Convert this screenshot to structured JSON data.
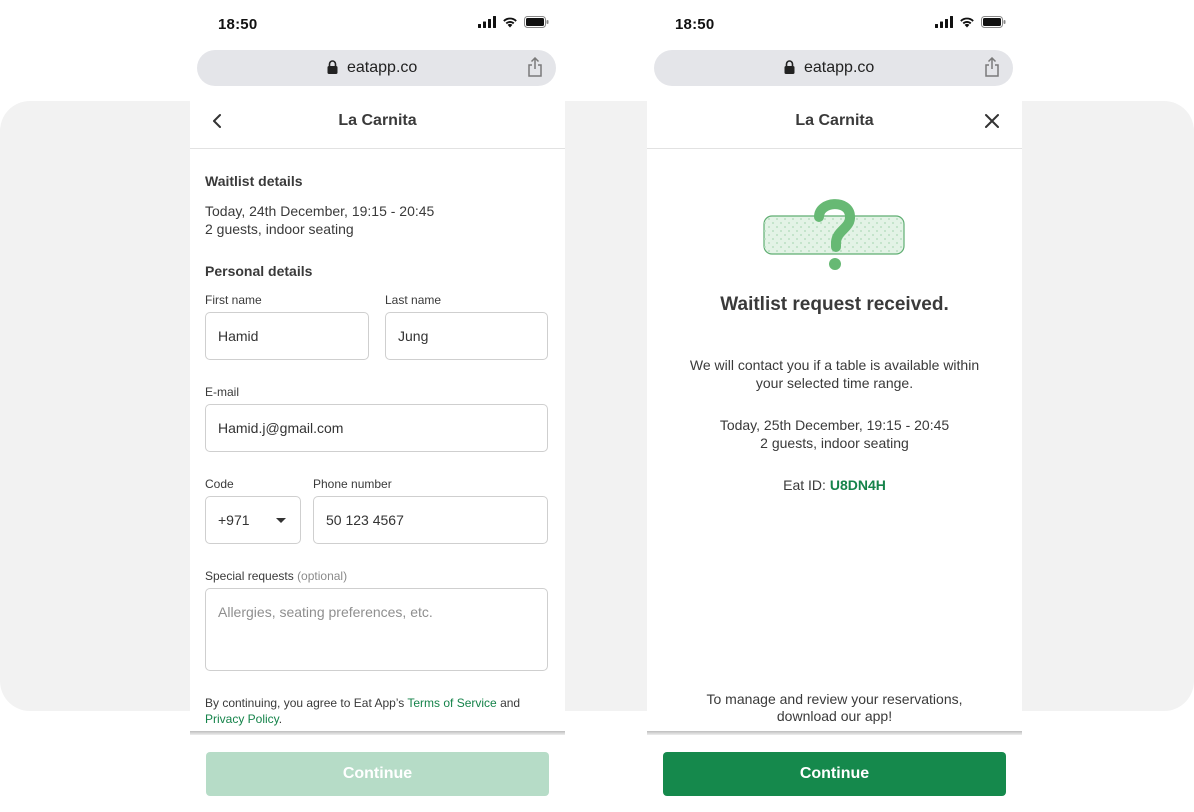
{
  "status_bar": {
    "time": "18:50"
  },
  "browser": {
    "url": "eatapp.co"
  },
  "colors": {
    "accent": "#15894c",
    "accent_disabled": "#b6dcc7",
    "link": "#15834a"
  },
  "left_screen": {
    "header": {
      "title": "La Carnita",
      "back_icon": "chevron-left-icon"
    },
    "waitlist": {
      "title": "Waitlist details",
      "date_line": "Today, 24th December, 19:15 - 20:45",
      "guests_line": "2 guests, indoor seating"
    },
    "personal": {
      "title": "Personal details",
      "first_name": {
        "label": "First name",
        "value": "Hamid"
      },
      "last_name": {
        "label": "Last name",
        "value": "Jung"
      },
      "email": {
        "label": "E-mail",
        "value": "Hamid.j@gmail.com"
      },
      "code": {
        "label": "Code",
        "value": "+971"
      },
      "phone": {
        "label": "Phone number",
        "value": "50 123 4567"
      },
      "special": {
        "label": "Special requests",
        "optional": "(optional)",
        "placeholder": "Allergies, seating preferences, etc."
      }
    },
    "legal": {
      "prefix": "By continuing, you agree to Eat App’s ",
      "terms": "Terms of Service",
      "and": " and ",
      "privacy": "Privacy Policy",
      "suffix": "."
    },
    "continue_label": "Continue"
  },
  "right_screen": {
    "header": {
      "title": "La Carnita",
      "close_icon": "close-icon"
    },
    "illustration_icon": "question-mark-icon",
    "confirm_title": "Waitlist request received.",
    "contact_line1": "We will contact you if a table is available within",
    "contact_line2": "your selected time range.",
    "date_line": "Today, 25th December, 19:15 - 20:45",
    "guests_line": "2 guests, indoor seating",
    "eat_id_label": "Eat ID: ",
    "eat_id_value": "U8DN4H",
    "manage_line1": "To manage and review your reservations,",
    "manage_line2": "download our app!",
    "continue_label": "Continue"
  }
}
